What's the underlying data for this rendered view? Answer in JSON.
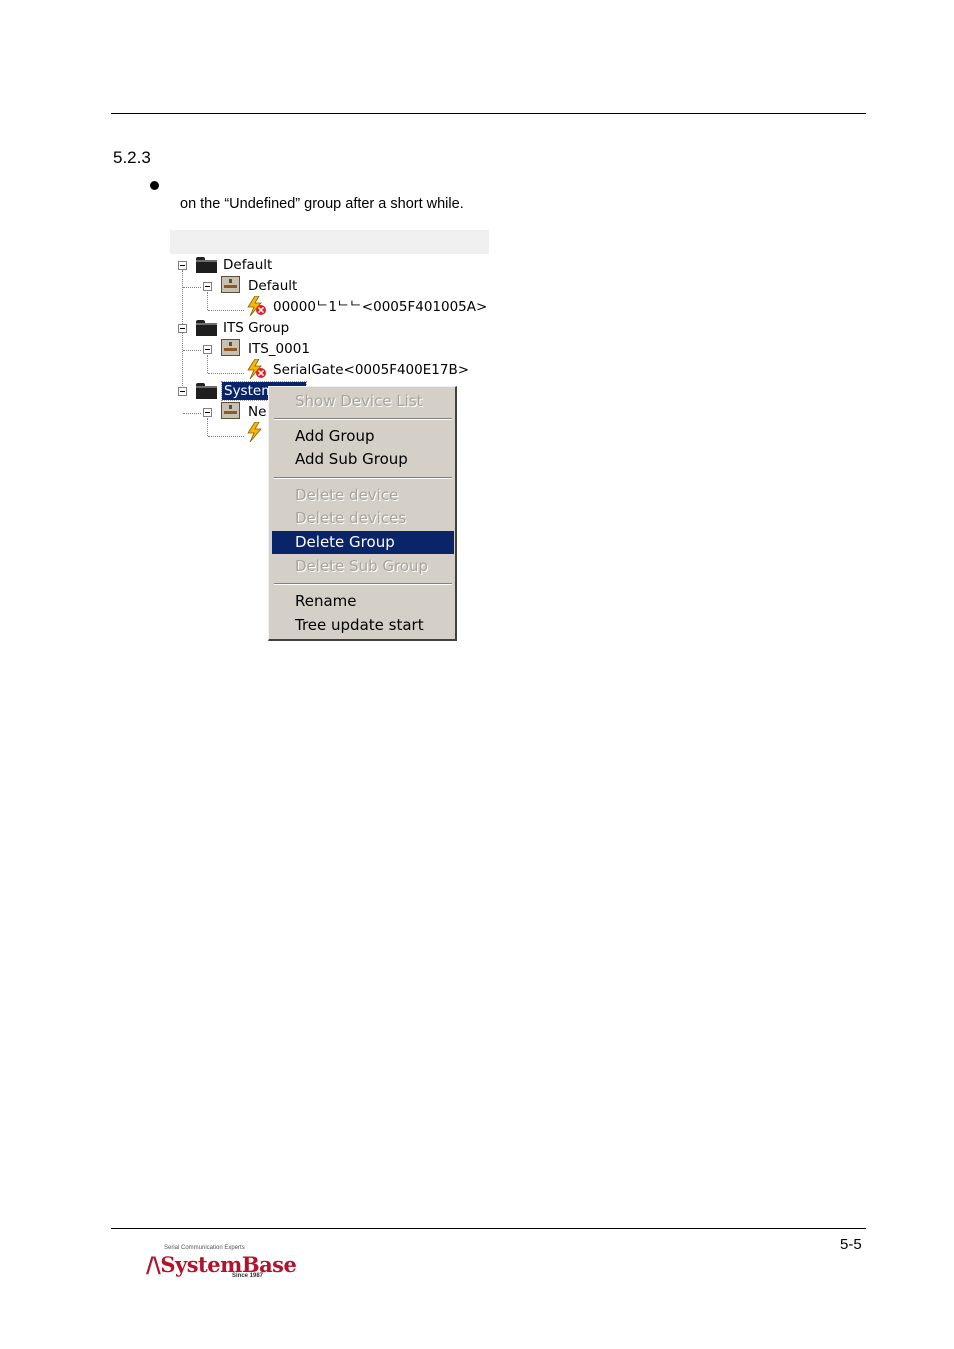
{
  "header": {
    "section_number": "5.2.3"
  },
  "body": {
    "bullet_text": "on the “Undefined” group after a short while."
  },
  "tree": {
    "nodes": [
      {
        "label": "Default"
      },
      {
        "label": "Default"
      },
      {
        "label": "00000ᄂ1ᄂᄂ<0005F401005A>"
      },
      {
        "label": "ITS Group"
      },
      {
        "label": "ITS_0001"
      },
      {
        "label": "SerialGate<0005F400E17B>"
      },
      {
        "label": "System"
      },
      {
        "label": "Ne"
      }
    ]
  },
  "context_menu": {
    "items": [
      {
        "label": "Show Device List",
        "enabled": false
      },
      {
        "label": "Add Group",
        "enabled": true
      },
      {
        "label": "Add Sub Group",
        "enabled": true
      },
      {
        "label": "Delete device",
        "enabled": false
      },
      {
        "label": "Delete devices",
        "enabled": false
      },
      {
        "label": "Delete Group",
        "enabled": true,
        "highlighted": true
      },
      {
        "label": "Delete Sub Group",
        "enabled": false
      },
      {
        "label": "Rename",
        "enabled": true
      },
      {
        "label": "Tree update start",
        "enabled": true
      }
    ],
    "highlight_color": "#0a246a",
    "menu_bg": "#d4d0c8"
  },
  "footer": {
    "page_number": "5-5",
    "logo": {
      "tagline": "Serial Communication Experts",
      "name": "SystemBase",
      "since": "Since 1987",
      "color": "#b3122a"
    }
  }
}
